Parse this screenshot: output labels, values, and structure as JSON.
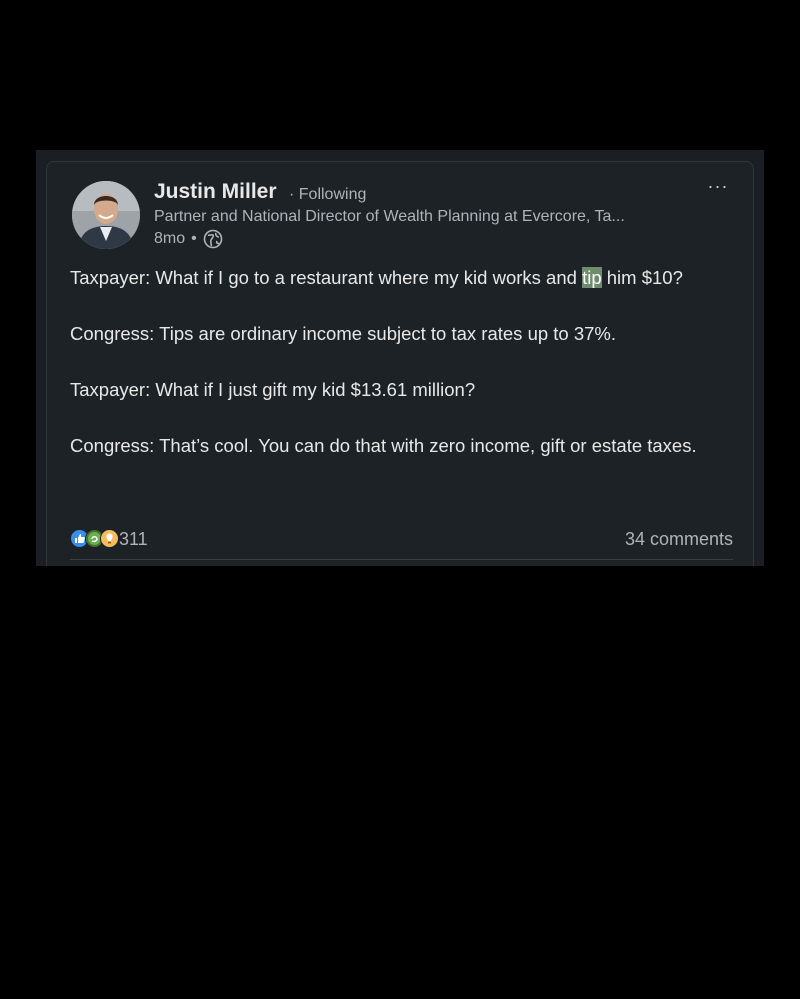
{
  "post": {
    "author": {
      "name": "Justin Miller",
      "follow_status": "· Following",
      "headline": "Partner and National Director of Wealth Planning at Evercore, Ta...",
      "time": "8mo",
      "visibility_icon": "globe-icon"
    },
    "more_label": "···",
    "body": {
      "p1_before": "Taxpayer: What if I go to a restaurant where my kid works and ",
      "p1_highlight": "tip",
      "p1_after": " him $10?",
      "p2": "Congress: Tips are ordinary income subject to tax rates up to 37%.",
      "p3": "Taxpayer: What if I just gift my kid $13.61 million?",
      "p4": "Congress: That’s cool. You can do that with zero income, gift or estate taxes."
    },
    "reactions": {
      "icons": [
        "like-icon",
        "celebrate-icon",
        "insightful-icon"
      ],
      "count": "311"
    },
    "comments": "34 comments"
  },
  "colors": {
    "page_background": "#000000",
    "card_background": "#1d2226",
    "highlight": "#6f8c6f",
    "like": "#378fe9",
    "celebrate": "#44712e",
    "insightful": "#f5bb5c"
  }
}
